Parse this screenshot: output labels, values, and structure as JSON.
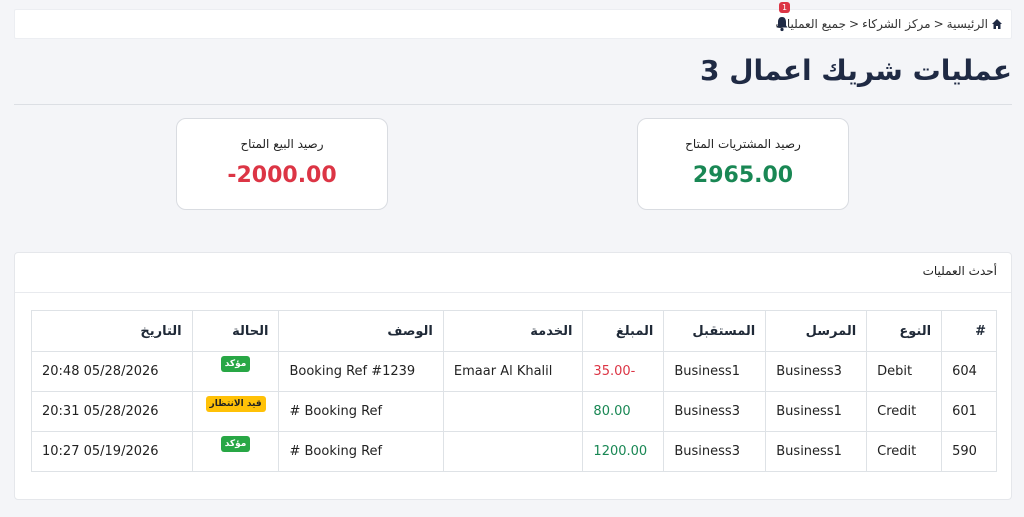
{
  "breadcrumb": {
    "home": "الرئيسية",
    "sep1": "<",
    "partners": "مركز الشركاء",
    "sep2": "<",
    "all_ops": "جميع العمليات"
  },
  "notifications": {
    "count": "1"
  },
  "page_title": "عمليات شريك اعمال 3",
  "cards": {
    "purchases": {
      "label": "رصيد المشتريات المتاح",
      "value": "2965.00",
      "color": "#198754"
    },
    "sales": {
      "label": "رصيد البيع المتاح",
      "value": "-2000.00",
      "color": "#dc3545"
    }
  },
  "panel": {
    "title": "أحدث العمليات"
  },
  "table": {
    "headers": {
      "id": "#",
      "type": "النوع",
      "sender": "المرسل",
      "receiver": "المستقبل",
      "amount": "المبلغ",
      "service": "الخدمة",
      "description": "الوصف",
      "status": "الحالة",
      "date": "التاريخ"
    },
    "rows": [
      {
        "id": "604",
        "type": "Debit",
        "sender": "Business3",
        "receiver": "Business1",
        "amount": "-35.00",
        "service": "Emaar Al Khalil",
        "description": "Booking Ref #1239",
        "status": "مؤكد",
        "date": "05/28/2026 20:48"
      },
      {
        "id": "601",
        "type": "Credit",
        "sender": "Business1",
        "receiver": "Business3",
        "amount": "80.00",
        "service": "",
        "description": "Booking Ref #",
        "status": "قيد الانتظار",
        "date": "05/28/2026 20:31"
      },
      {
        "id": "590",
        "type": "Credit",
        "sender": "Business1",
        "receiver": "Business3",
        "amount": "1200.00",
        "service": "",
        "description": "Booking Ref #",
        "status": "مؤكد",
        "date": "05/19/2026 10:27"
      }
    ]
  }
}
